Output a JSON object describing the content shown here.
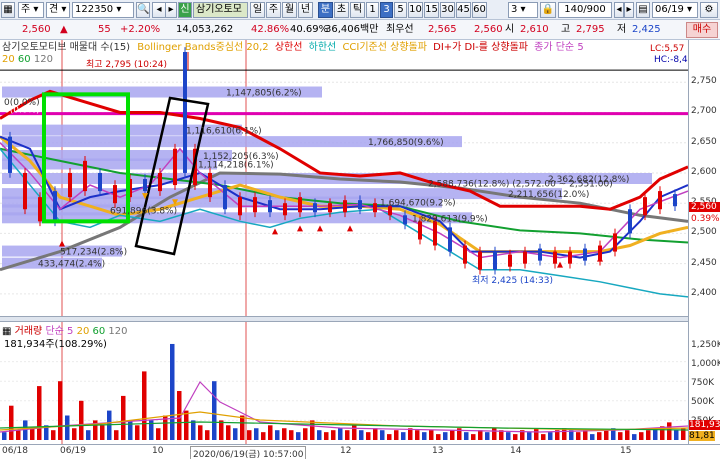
{
  "toolbar": {
    "market": "주",
    "view": "견",
    "code": "122350",
    "badge": "신",
    "name": "삼기오토모",
    "periods": [
      "일",
      "주",
      "월",
      "년",
      "분",
      "초",
      "틱"
    ],
    "period_selected": "분",
    "minutes": [
      "1",
      "3",
      "5",
      "10",
      "15",
      "30",
      "45",
      "60"
    ],
    "minute_selected": "3",
    "interval": "3",
    "count": "140/900",
    "date": "06/19"
  },
  "quote": {
    "price": "2,560",
    "change": "55",
    "change_pct": "+2.20%",
    "volume": "14,053,262",
    "volume_ratio": "42.86%",
    "turnover_ratio": "40.69%",
    "amount": "36,406백만",
    "seller_label": "최우선",
    "ask": "2,565",
    "bid": "2,560",
    "open_label": "시",
    "open": "2,610",
    "high_label": "고",
    "high": "2,795",
    "low_label": "저",
    "low": "2,425",
    "trade_button": "매수"
  },
  "legend": {
    "title": "삼기오토모티브 매물대 수(15)",
    "ma_periods": [
      "20",
      "60",
      "120"
    ],
    "bollinger": "Bollinger Bands중심선 20,2",
    "upper": "상한선",
    "lower": "하한선",
    "cci": "CCI기준선 상향돌파",
    "dmi": "DI+가 DI-를 상향돌파",
    "close": "종가 단순 5",
    "right_small1": "LC:5,57",
    "right_small2": "HC:-8,4"
  },
  "annotations": {
    "high": "최고 2,795 (10:24)",
    "low": "최저 2,425 (14:33)",
    "pct_a": "0(0.0%)",
    "pct_b": "0(0.0%)",
    "range_note": "2,588,736(12.8%) (2,572.00 ~ 2,551.00)"
  },
  "chart_data": {
    "type": "line",
    "y_ticks": [
      "2,750",
      "2,700",
      "2,650",
      "2,600",
      "2,550",
      "2,500",
      "2,450",
      "2,400"
    ],
    "ylim": [
      2380,
      2800
    ],
    "x_ticks": [
      "06/18",
      "06/19",
      "10",
      "2020/06/19(금) 10:57:00",
      "12",
      "13",
      "14",
      "15"
    ],
    "current_price": "2,560",
    "current_pct": "0.39%",
    "volume_profile": [
      {
        "label": "1,147,805(6.2%)",
        "price": 2733
      },
      {
        "label": "1,116,610(6.1%)",
        "price": 2670
      },
      {
        "label": "1,766,850(9.6%)",
        "price": 2651
      },
      {
        "label": "1,152,205(6.3%)",
        "price": 2628
      },
      {
        "label": "1,114,218(6.1%)",
        "price": 2614
      },
      {
        "label": "2,362,682(12.8%)",
        "price": 2590
      },
      {
        "label": "2,211,656(12.0%)",
        "price": 2565
      },
      {
        "label": "1,694,670(9.2%)",
        "price": 2551
      },
      {
        "label": "691,896(3.8%)",
        "price": 2538
      },
      {
        "label": "1,829,613(9.9%)",
        "price": 2525
      },
      {
        "label": "517,234(2.8%)",
        "price": 2470
      },
      {
        "label": "433,474(2.4%)",
        "price": 2450
      }
    ],
    "volume_legend": {
      "title": "거래량",
      "simple": "단순 5",
      "periods": [
        "20",
        "60",
        "120"
      ],
      "value": "181,934주(108.29%)"
    },
    "volume_ticks": [
      "1,250K",
      "1,000K",
      "750K",
      "500K",
      "250K"
    ],
    "volume_current": "181,93",
    "volume_current2": "81,81"
  }
}
